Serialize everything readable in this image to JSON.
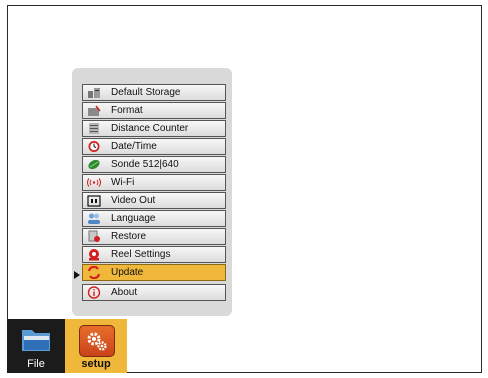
{
  "menu": {
    "items": [
      {
        "label": "Default Storage",
        "icon": "storage-icon"
      },
      {
        "label": "Format",
        "icon": "format-icon"
      },
      {
        "label": "Distance Counter",
        "icon": "distance-counter-icon"
      },
      {
        "label": "Date/Time",
        "icon": "clock-icon"
      },
      {
        "label": "Sonde 512|640",
        "icon": "sonde-icon"
      },
      {
        "label": "Wi-Fi",
        "icon": "wifi-icon"
      },
      {
        "label": "Video Out",
        "icon": "video-out-icon"
      },
      {
        "label": "Language",
        "icon": "language-icon"
      },
      {
        "label": "Restore",
        "icon": "restore-icon"
      },
      {
        "label": "Reel Settings",
        "icon": "reel-icon"
      },
      {
        "label": "Update",
        "icon": "update-icon"
      },
      {
        "label": "About",
        "icon": "info-icon"
      }
    ],
    "selected": "Update"
  },
  "taskbar": {
    "file_label": "File",
    "setup_label": "setup"
  },
  "colors": {
    "selected": "#f0b83a",
    "menu_panel": "#d9d9d9",
    "setup_icon": "#e05a22"
  }
}
